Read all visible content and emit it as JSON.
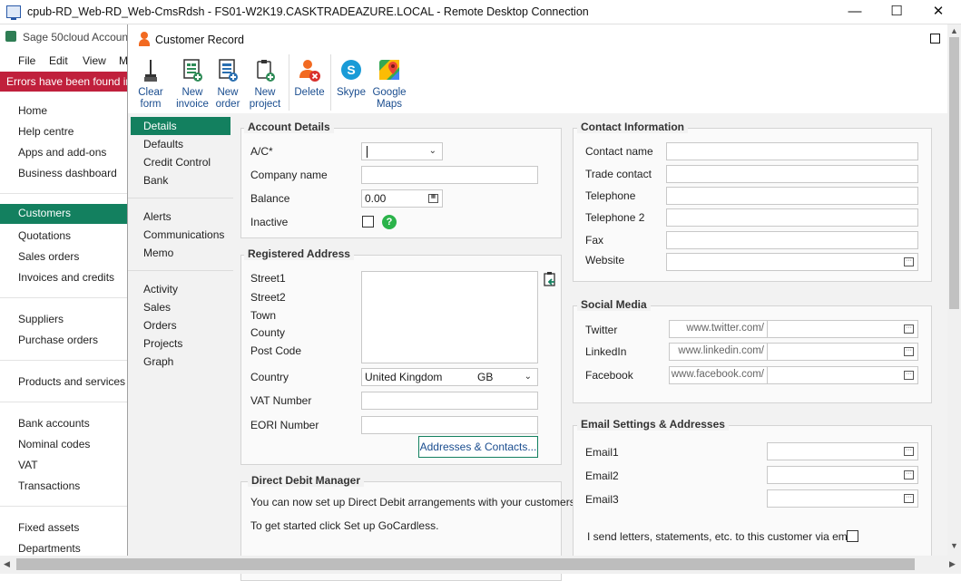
{
  "rdp": {
    "title": "cpub-RD_Web-RD_Web-CmsRdsh - FS01-W2K19.CASKTRADEAZURE.LOCAL - Remote Desktop Connection",
    "min": "—",
    "max": "☐",
    "close": "✕"
  },
  "sage": {
    "title": "Sage 50cloud Accoun",
    "menu": [
      "File",
      "Edit",
      "View",
      "M"
    ],
    "error": "Errors have been found in y",
    "nav": [
      "Home",
      "Help centre",
      "Apps and add-ons",
      "Business dashboard",
      "Customers",
      "Quotations",
      "Sales orders",
      "Invoices and credits",
      "Suppliers",
      "Purchase orders",
      "Products and services",
      "Bank accounts",
      "Nominal codes",
      "VAT",
      "Transactions",
      "Fixed assets",
      "Departments"
    ],
    "active": "Customers"
  },
  "window": {
    "title": "Customer Record"
  },
  "toolbar": {
    "clear_form": [
      "Clear",
      "form"
    ],
    "new_invoice": [
      "New",
      "invoice"
    ],
    "new_order": [
      "New",
      "order"
    ],
    "new_project": [
      "New",
      "project"
    ],
    "delete": [
      "Delete",
      ""
    ],
    "skype": [
      "Skype",
      ""
    ],
    "google_maps": [
      "Google",
      "Maps"
    ]
  },
  "left_panel": {
    "items": [
      "Details",
      "Defaults",
      "Credit Control",
      "Bank",
      "Alerts",
      "Communications",
      "Memo",
      "Activity",
      "Sales",
      "Orders",
      "Projects",
      "Graph"
    ],
    "active": "Details"
  },
  "account_details": {
    "title": "Account Details",
    "ac_label": "A/C*",
    "ac_value": "",
    "company_label": "Company name",
    "company_value": "",
    "balance_label": "Balance",
    "balance_value": "0.00",
    "inactive_label": "Inactive",
    "inactive_checked": false
  },
  "registered_address": {
    "title": "Registered Address",
    "labels": [
      "Street1",
      "Street2",
      "Town",
      "County",
      "Post Code"
    ],
    "country_label": "Country",
    "country_value": "United Kingdom",
    "country_code": "GB",
    "vat_label": "VAT Number",
    "eori_label": "EORI Number",
    "addresses_button": "Addresses & Contacts..."
  },
  "direct_debit": {
    "title": "Direct Debit Manager",
    "line1": "You can now set up Direct Debit arrangements with your customers.",
    "line2": "To get started click Set up GoCardless."
  },
  "contact_info": {
    "title": "Contact Information",
    "labels": [
      "Contact name",
      "Trade contact",
      "Telephone",
      "Telephone 2",
      "Fax",
      "Website"
    ]
  },
  "social_media": {
    "title": "Social Media",
    "rows": [
      {
        "label": "Twitter",
        "prefix": "www.twitter.com/"
      },
      {
        "label": "LinkedIn",
        "prefix": "www.linkedin.com/"
      },
      {
        "label": "Facebook",
        "prefix": "www.facebook.com/"
      }
    ]
  },
  "email_settings": {
    "title": "Email Settings & Addresses",
    "labels": [
      "Email1",
      "Email2",
      "Email3"
    ],
    "send_letters_label": "I send letters, statements, etc. to this customer via email",
    "send_letters_checked": false
  },
  "colors": {
    "accent_green": "#13805f",
    "error_red": "#c0203c",
    "link_blue": "#1a4d8f"
  }
}
